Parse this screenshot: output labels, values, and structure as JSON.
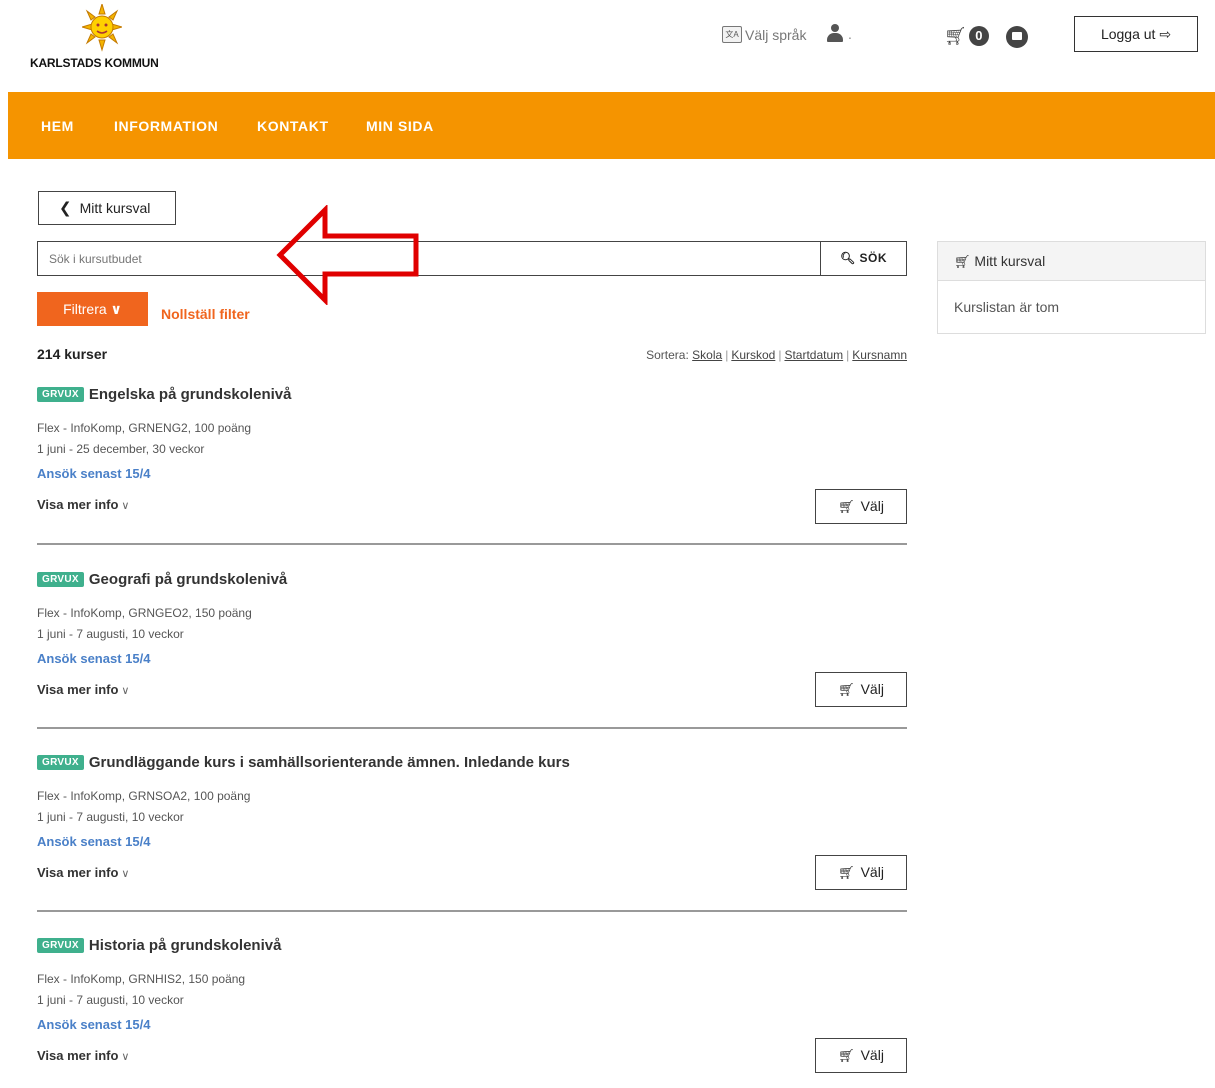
{
  "header": {
    "logo_text": "KARLSTADS KOMMUN",
    "language_label": "Välj språk",
    "language_icon_text": "文A",
    "user_name": ".",
    "cart_count": "0",
    "logout_label": "Logga ut"
  },
  "nav": {
    "items": [
      "HEM",
      "INFORMATION",
      "KONTAKT",
      "MIN SIDA"
    ],
    "color": "#f59400"
  },
  "main": {
    "back_label": "Mitt kursval",
    "search_placeholder": "Sök i kursutbudet",
    "search_button": "SÖK",
    "filter_label": "Filtrera",
    "reset_label": "Nollställ filter",
    "course_count": "214 kurser",
    "sort_label": "Sortera:",
    "sort_options": [
      "Skola",
      "Kurskod",
      "Startdatum",
      "Kursnamn"
    ],
    "choose_label": "Välj",
    "more_info_label": "Visa mer info",
    "courses": [
      {
        "tag": "GRVUX",
        "title": "Engelska på grundskolenivå",
        "info": "Flex - InfoKomp, GRNENG2, 100 poäng",
        "dates": "1 juni - 25 december, 30 veckor",
        "deadline": "Ansök senast 15/4"
      },
      {
        "tag": "GRVUX",
        "title": "Geografi på grundskolenivå",
        "info": "Flex - InfoKomp, GRNGEO2, 150 poäng",
        "dates": "1 juni - 7 augusti, 10 veckor",
        "deadline": "Ansök senast 15/4"
      },
      {
        "tag": "GRVUX",
        "title": "Grundläggande kurs i samhällsorienterande ämnen. Inledande kurs",
        "info": "Flex - InfoKomp, GRNSOA2, 100 poäng",
        "dates": "1 juni - 7 augusti, 10 veckor",
        "deadline": "Ansök senast 15/4"
      },
      {
        "tag": "GRVUX",
        "title": "Historia på grundskolenivå",
        "info": "Flex - InfoKomp, GRNHIS2, 150 poäng",
        "dates": "1 juni - 7 augusti, 10 veckor",
        "deadline": "Ansök senast 15/4"
      }
    ]
  },
  "sidebar": {
    "title": "Mitt kursval",
    "empty_text": "Kurslistan är tom"
  },
  "colors": {
    "accent": "#f59400",
    "filter": "#f0651e",
    "tag": "#3fb08d",
    "link": "#4a80c8",
    "annotation_arrow": "#e00000"
  },
  "icons": {
    "cart": "cart-icon",
    "mail": "mail-icon",
    "user": "user-icon",
    "language": "translate-icon",
    "search": "search-icon",
    "logout": "logout-icon",
    "back": "chevron-left-icon",
    "filter": "chevron-down-icon"
  }
}
